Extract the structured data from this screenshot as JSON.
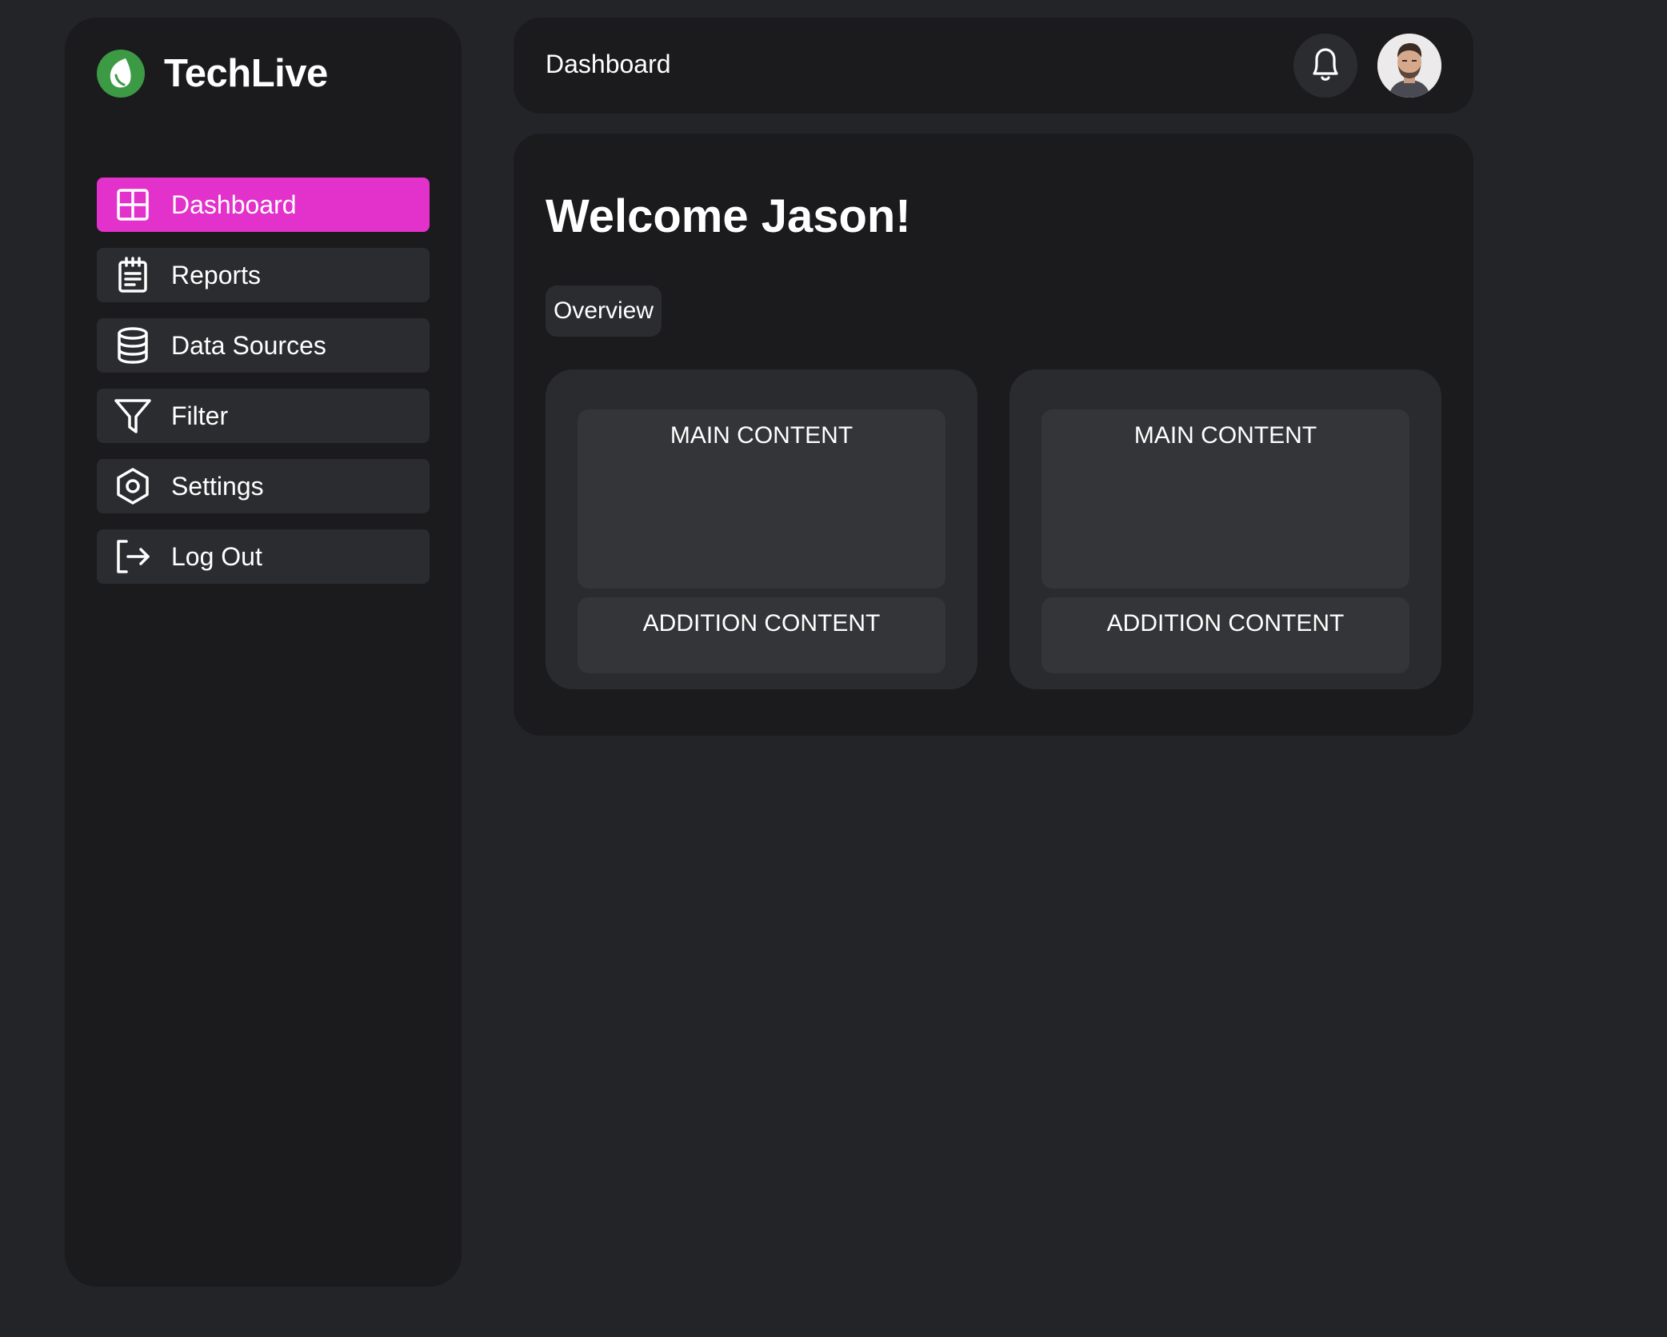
{
  "brand": {
    "name": "TechLive",
    "logo_icon": "leaf-icon",
    "logo_color": "#3d9a44"
  },
  "sidebar": {
    "items": [
      {
        "label": "Dashboard",
        "icon": "dashboard-grid-icon",
        "active": true
      },
      {
        "label": "Reports",
        "icon": "notepad-icon",
        "active": false
      },
      {
        "label": "Data Sources",
        "icon": "database-icon",
        "active": false
      },
      {
        "label": "Filter",
        "icon": "filter-funnel-icon",
        "active": false
      },
      {
        "label": "Settings",
        "icon": "hexagon-gear-icon",
        "active": false
      },
      {
        "label": "Log Out",
        "icon": "logout-arrow-icon",
        "active": false
      }
    ],
    "active_color": "#e331cb"
  },
  "header": {
    "title": "Dashboard",
    "notification_icon": "bell-icon",
    "avatar": "user-avatar"
  },
  "main": {
    "welcome": "Welcome Jason!",
    "tab": "Overview",
    "cards": [
      {
        "main": "MAIN CONTENT",
        "addition": "ADDITION CONTENT"
      },
      {
        "main": "MAIN CONTENT",
        "addition": "ADDITION CONTENT"
      }
    ]
  }
}
